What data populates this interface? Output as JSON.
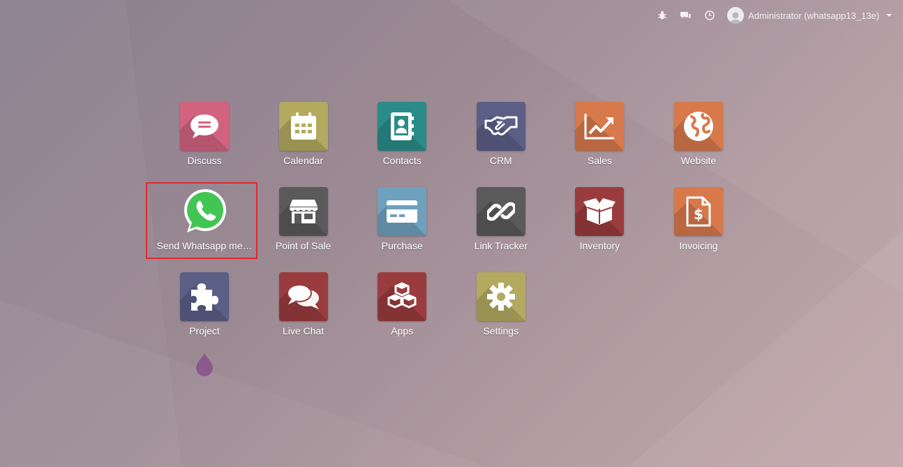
{
  "topbar": {
    "icons": [
      "bug-icon",
      "chat-bubbles-icon",
      "clock-icon"
    ],
    "user_label": "Administrator (whatsapp13_13e)"
  },
  "apps": [
    {
      "label": "Discuss",
      "icon": "chat-icon",
      "color": "#d2637f"
    },
    {
      "label": "Calendar",
      "icon": "calendar-icon",
      "color": "#b3aa60"
    },
    {
      "label": "Contacts",
      "icon": "address-book-icon",
      "color": "#2a8c89"
    },
    {
      "label": "CRM",
      "icon": "handshake-icon",
      "color": "#5b5f86"
    },
    {
      "label": "Sales",
      "icon": "chart-up-icon",
      "color": "#d8794c"
    },
    {
      "label": "Website",
      "icon": "globe-icon",
      "color": "#d8794c"
    },
    {
      "label": "Send Whatsapp me…",
      "icon": "whatsapp-icon",
      "color": "#43c553"
    },
    {
      "label": "Point of Sale",
      "icon": "shop-icon",
      "color": "#5a5a5a"
    },
    {
      "label": "Purchase",
      "icon": "credit-card-icon",
      "color": "#6ea1be"
    },
    {
      "label": "Link Tracker",
      "icon": "link-icon",
      "color": "#5a5a5a"
    },
    {
      "label": "Inventory",
      "icon": "box-icon",
      "color": "#9a3c3e"
    },
    {
      "label": "Invoicing",
      "icon": "invoice-icon",
      "color": "#d8794c"
    },
    {
      "label": "Project",
      "icon": "puzzle-icon",
      "color": "#5b5f86"
    },
    {
      "label": "Live Chat",
      "icon": "chat-bubbles-icon",
      "color": "#9a3c3e"
    },
    {
      "label": "Apps",
      "icon": "cubes-icon",
      "color": "#9a3c3e"
    },
    {
      "label": "Settings",
      "icon": "gear-icon",
      "color": "#b3aa60"
    }
  ]
}
